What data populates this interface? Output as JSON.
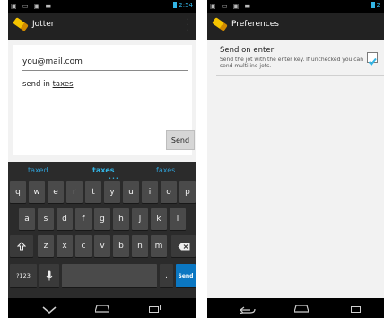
{
  "left_screen": {
    "status_time": "2:54",
    "app_title": "Jotter",
    "email_value": "you@mail.com",
    "message_prefix": "send in ",
    "message_underlined": "taxes",
    "send_button_label": "Send",
    "keyboard": {
      "suggestions": [
        "taxed",
        "taxes",
        "faxes"
      ],
      "row1": [
        "q",
        "w",
        "e",
        "r",
        "t",
        "y",
        "u",
        "i",
        "o",
        "p"
      ],
      "row2": [
        "a",
        "s",
        "d",
        "f",
        "g",
        "h",
        "j",
        "k",
        "l"
      ],
      "row3": [
        "z",
        "x",
        "c",
        "v",
        "b",
        "n",
        "m"
      ],
      "symbols_label": "?123",
      "period_label": ".",
      "enter_label": "Send"
    }
  },
  "right_screen": {
    "status_time": "2",
    "app_title": "Preferences",
    "preference": {
      "title": "Send on enter",
      "summary": "Send the jot with the enter key. If unchecked you can send multiline jots.",
      "checked": true
    }
  },
  "colors": {
    "accent": "#33b5e5",
    "action_bar": "#222222",
    "keyboard": "#2b2b2b",
    "key": "#4a4a4a",
    "send_key": "#0b77c2"
  }
}
